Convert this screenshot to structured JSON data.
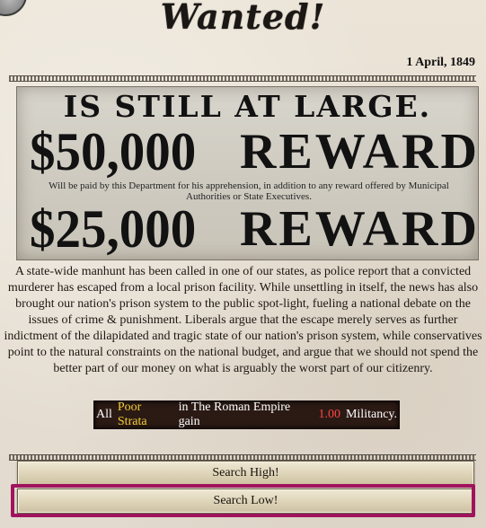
{
  "event": {
    "title": "Wanted!",
    "date": "1 April, 1849"
  },
  "poster": {
    "headline": "IS STILL AT LARGE.",
    "amount1": "$50,000",
    "reward_word1": "REWARD",
    "fine_print": "Will be paid by this Department for his apprehension, in addition to any reward offered by Municipal Authorities or State Executives.",
    "amount2": "$25,000",
    "reward_word2": "REWARD"
  },
  "description": "A state-wide manhunt has been called in one of our states, as police report that a convicted murderer has escaped from a local prison facility. While unsettling in itself, the news has also brought our nation's prison system to the public spot-light, fueling a national debate on the issues of crime & punishment. Liberals argue that the escape merely serves as further indictment of the dilapidated and tragic state of our nation's prison system, while conservatives point to the natural constraints on the national budget, and argue that we should not spend the better part of our money on what is arguably the worst part of our citizenry.",
  "effect": {
    "prefix": "All",
    "group": "Poor Strata",
    "middle": "in The Roman Empire gain",
    "value": "1.00",
    "suffix": "Militancy.",
    "colors": {
      "highlight": "#f3cc3a",
      "value": "#ff4343",
      "background": "#2b1a14"
    }
  },
  "options": [
    {
      "label": "Search High!"
    },
    {
      "label": "Search Low!",
      "selected": true
    }
  ],
  "colors": {
    "selection_frame": "#a0145e",
    "paper": "#e7e0d3"
  }
}
